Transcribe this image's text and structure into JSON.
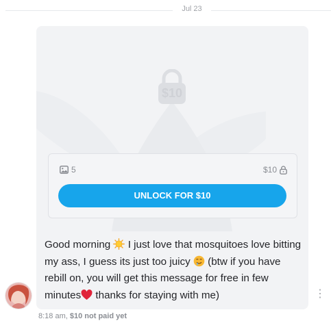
{
  "date_divider": "Jul 23",
  "locked_post": {
    "lock_price": "$10",
    "media_count": "5",
    "price": "$10",
    "unlock_label": "UNLOCK FOR $10"
  },
  "message": {
    "segments": [
      "Good morning ",
      " I just love that mosquitoes love bitting my ass, I guess its just too juicy ",
      " (btw if you have rebill on, you will get this message for free in few minutes",
      " thanks for staying with me)"
    ],
    "emoji_icons": [
      "sun-emoji-icon",
      "drooling-face-emoji-icon",
      "red-heart-emoji-icon"
    ]
  },
  "footer": {
    "time": "8:18 am,",
    "paid_status": "$10 not paid yet"
  },
  "colors": {
    "accent": "#17a5eb",
    "bubble_bg": "#f2f3f5",
    "meta_text": "#8a8d93"
  }
}
